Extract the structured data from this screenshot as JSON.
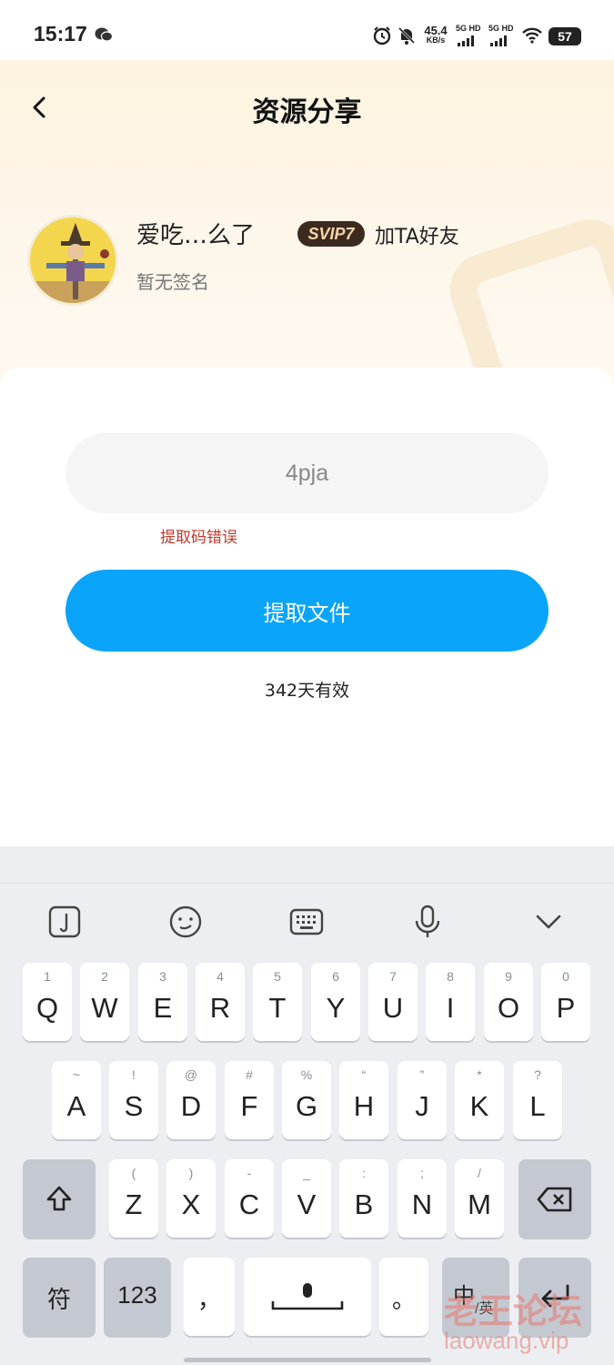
{
  "status_bar": {
    "time": "15:17",
    "net_speed_value": "45.4",
    "net_speed_unit": "KB/s",
    "sim1_label": "5G HD",
    "sim2_label": "5G HD",
    "battery": "57"
  },
  "header": {
    "title": "资源分享",
    "username": "爱吃…么了",
    "vip_badge": "SVIP7",
    "add_friend": "加TA好友",
    "signature": "暂无签名"
  },
  "card": {
    "code_value": "4pja",
    "error_message": "提取码错误",
    "extract_button": "提取文件",
    "validity": "342天有效"
  },
  "keyboard": {
    "toolbar_icons": [
      "text-cursor-icon",
      "emoji-icon",
      "keyboard-icon",
      "microphone-icon",
      "chevron-down-icon"
    ],
    "row1": [
      {
        "main": "Q",
        "hint": "1"
      },
      {
        "main": "W",
        "hint": "2"
      },
      {
        "main": "E",
        "hint": "3"
      },
      {
        "main": "R",
        "hint": "4"
      },
      {
        "main": "T",
        "hint": "5"
      },
      {
        "main": "Y",
        "hint": "6"
      },
      {
        "main": "U",
        "hint": "7"
      },
      {
        "main": "I",
        "hint": "8"
      },
      {
        "main": "O",
        "hint": "9"
      },
      {
        "main": "P",
        "hint": "0"
      }
    ],
    "row2": [
      {
        "main": "A",
        "hint": "~"
      },
      {
        "main": "S",
        "hint": "!"
      },
      {
        "main": "D",
        "hint": "@"
      },
      {
        "main": "F",
        "hint": "#"
      },
      {
        "main": "G",
        "hint": "%"
      },
      {
        "main": "H",
        "hint": "“"
      },
      {
        "main": "J",
        "hint": "”"
      },
      {
        "main": "K",
        "hint": "*"
      },
      {
        "main": "L",
        "hint": "?"
      }
    ],
    "row3": [
      {
        "main": "Z",
        "hint": "("
      },
      {
        "main": "X",
        "hint": ")"
      },
      {
        "main": "C",
        "hint": "-"
      },
      {
        "main": "V",
        "hint": "_"
      },
      {
        "main": "B",
        "hint": ":"
      },
      {
        "main": "N",
        "hint": ";"
      },
      {
        "main": "M",
        "hint": "/"
      }
    ],
    "symbols_key": "符",
    "numbers_key": "123",
    "comma_key": "，",
    "period_key": "。",
    "lang_key_main": "中",
    "lang_key_sub": "/英"
  },
  "watermark": {
    "cn": "老王论坛",
    "en": "laowang.vip"
  },
  "colors": {
    "primary_button": "#0aa4fa",
    "error": "#c0392b",
    "vip_badge_bg": "#3d2a1f"
  }
}
